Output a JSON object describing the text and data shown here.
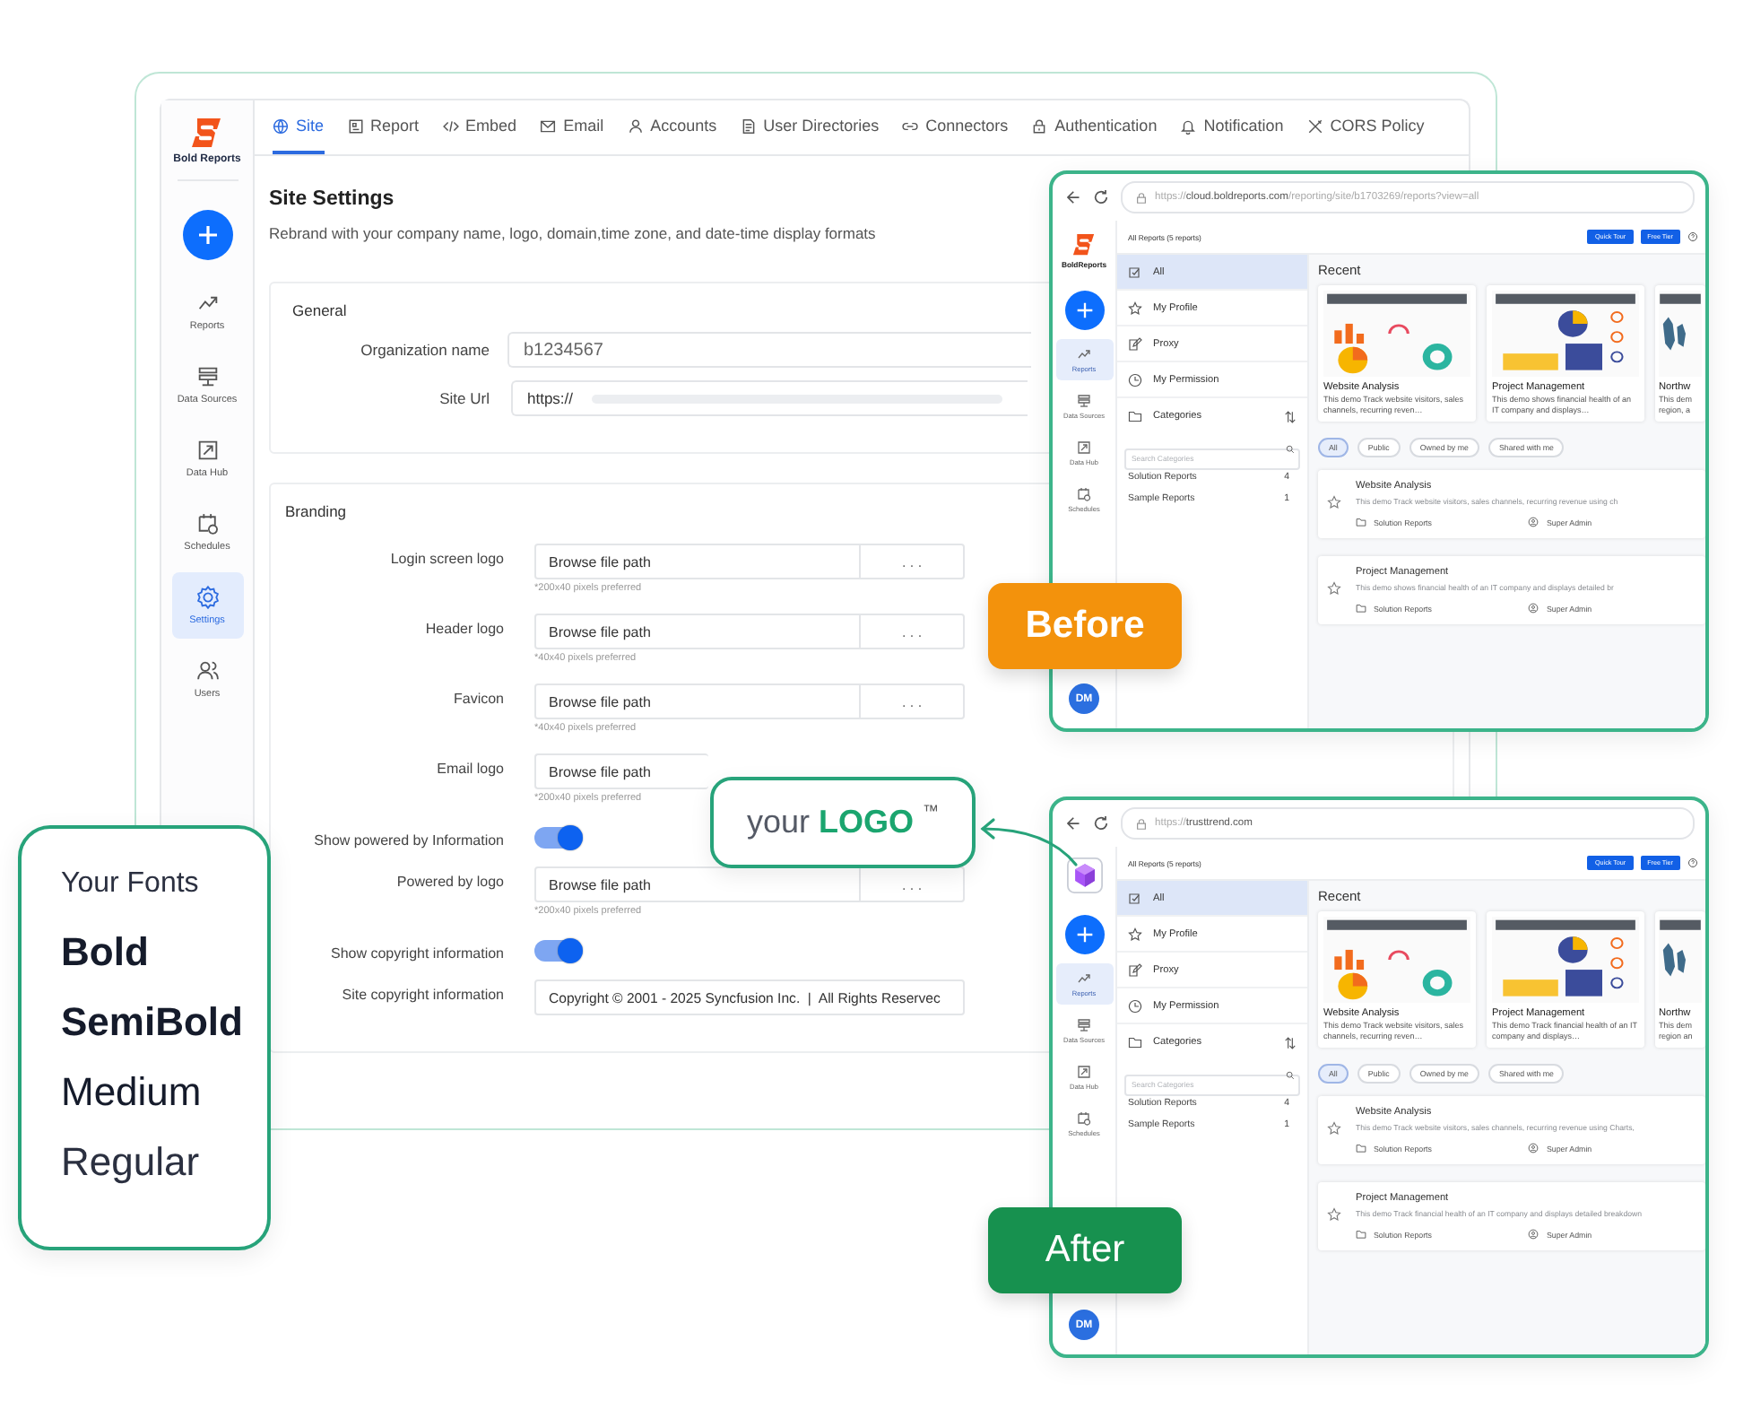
{
  "app": {
    "logo_text": "Bold Reports",
    "sidebar": [
      {
        "label": "Reports",
        "selected": false
      },
      {
        "label": "Data Sources",
        "selected": false
      },
      {
        "label": "Data Hub",
        "selected": false
      },
      {
        "label": "Schedules",
        "selected": false
      },
      {
        "label": "Settings",
        "selected": true
      },
      {
        "label": "Users",
        "selected": false
      }
    ],
    "tabs": [
      {
        "label": "Site",
        "selected": true
      },
      {
        "label": "Report",
        "selected": false
      },
      {
        "label": "Embed",
        "selected": false
      },
      {
        "label": "Email",
        "selected": false
      },
      {
        "label": "Accounts",
        "selected": false
      },
      {
        "label": "User Directories",
        "selected": false
      },
      {
        "label": "Connectors",
        "selected": false
      },
      {
        "label": "Authentication",
        "selected": false
      },
      {
        "label": "Notification",
        "selected": false
      },
      {
        "label": "CORS Policy",
        "selected": false
      }
    ],
    "title": "Site Settings",
    "subtitle": "Rebrand with your company name, logo, domain,time zone, and date-time display formats",
    "general": {
      "title": "General",
      "fields": [
        {
          "label": "Organization name",
          "value": "b1234567"
        },
        {
          "label": "Site Url",
          "value": "https://"
        }
      ]
    },
    "branding": {
      "title": "Branding",
      "rows": [
        {
          "kind": "file",
          "label": "Login screen logo",
          "value": "Browse file path",
          "button": ". . .",
          "hint": "*200x40 pixels preferred"
        },
        {
          "kind": "file",
          "label": "Header logo",
          "value": "Browse file path",
          "button": ". . .",
          "hint": "*40x40 pixels preferred"
        },
        {
          "kind": "file",
          "label": "Favicon",
          "value": "Browse file path",
          "button": ". . .",
          "hint": "*40x40 pixels preferred"
        },
        {
          "kind": "file",
          "label": "Email logo",
          "value": "Browse file path",
          "hint": "*200x40 pixels preferred"
        },
        {
          "kind": "toggle",
          "label": "Show powered by Information",
          "on": true
        },
        {
          "kind": "file",
          "label": "Powered by logo",
          "value": "Browse file path",
          "button": ". . .",
          "hint": "*200x40 pixels preferred"
        },
        {
          "kind": "toggle",
          "label": "Show copyright information",
          "on": true
        },
        {
          "kind": "text",
          "label": "Site copyright information",
          "value": "Copyright © 2001 - 2025 Syncfusion Inc.  |  All Rights Reservec"
        }
      ]
    }
  },
  "windows": [
    {
      "kind": "before",
      "badge": "Before",
      "url": {
        "scheme": "https://",
        "host": "cloud.boldreports.com",
        "path": "/reporting/site/b1703269/reports?view=all"
      },
      "logo_text": "BoldReports",
      "sidebar": [
        {
          "label": "Reports",
          "selected": true
        },
        {
          "label": "Data Sources",
          "selected": false
        },
        {
          "label": "Data Hub",
          "selected": false
        },
        {
          "label": "Schedules",
          "selected": false
        }
      ],
      "avatar": "DM",
      "heading": "All Reports (5 reports)",
      "buttons": [
        "Quick Tour",
        "Free Tier"
      ],
      "nav": [
        {
          "label": "All",
          "selected": true
        },
        {
          "label": "My Profile",
          "selected": false
        },
        {
          "label": "Proxy",
          "selected": false
        },
        {
          "label": "My Permission",
          "selected": false
        }
      ],
      "categories_label": "Categories",
      "search_placeholder": "Search Categories",
      "categories": [
        {
          "name": "Solution Reports",
          "count": "4"
        },
        {
          "name": "Sample Reports",
          "count": "1"
        }
      ],
      "recent_title": "Recent",
      "recent": [
        {
          "title": "Website Analysis",
          "description": "This demo Track website visitors, sales channels, recurring reven…"
        },
        {
          "title": "Project Management",
          "description": "This demo shows financial health of an IT company and displays…"
        },
        {
          "title": "Northw",
          "description": "This dem region, a"
        }
      ],
      "filters": [
        {
          "label": "All",
          "selected": true
        },
        {
          "label": "Public",
          "selected": false
        },
        {
          "label": "Owned by me",
          "selected": false
        },
        {
          "label": "Shared with me",
          "selected": false
        }
      ],
      "reports": [
        {
          "title": "Website Analysis",
          "description": "This demo Track website visitors, sales channels, recurring revenue using ch",
          "category": "Solution Reports",
          "owner": "Super Admin"
        },
        {
          "title": "Project Management",
          "description": "This demo shows financial health of an IT company and displays detailed br",
          "category": "Solution Reports",
          "owner": "Super Admin"
        }
      ]
    },
    {
      "kind": "after",
      "badge": "After",
      "url": {
        "scheme": "https://",
        "host": "trusttrend.com"
      },
      "sidebar": [
        {
          "label": "Reports",
          "selected": true
        },
        {
          "label": "Data Sources",
          "selected": false
        },
        {
          "label": "Data Hub",
          "selected": false
        },
        {
          "label": "Schedules",
          "selected": false
        }
      ],
      "avatar": "DM",
      "heading": "All Reports (5 reports)",
      "buttons": [
        "Quick Tour",
        "Free Tier"
      ],
      "nav": [
        {
          "label": "All",
          "selected": true
        },
        {
          "label": "My Profile",
          "selected": false
        },
        {
          "label": "Proxy",
          "selected": false
        },
        {
          "label": "My Permission",
          "selected": false
        }
      ],
      "categories_label": "Categories",
      "search_placeholder": "Search Categories",
      "categories": [
        {
          "name": "Solution Reports",
          "count": "4"
        },
        {
          "name": "Sample Reports",
          "count": "1"
        }
      ],
      "recent_title": "Recent",
      "recent": [
        {
          "title": "Website Analysis",
          "description": "This demo Track website visitors, sales channels, recurring reven…"
        },
        {
          "title": "Project Management",
          "description": "This demo Track financial health of an IT company and displays…"
        },
        {
          "title": "Northw",
          "description": "This dem region an"
        }
      ],
      "filters": [
        {
          "label": "All",
          "selected": true
        },
        {
          "label": "Public",
          "selected": false
        },
        {
          "label": "Owned by me",
          "selected": false
        },
        {
          "label": "Shared with me",
          "selected": false
        }
      ],
      "reports": [
        {
          "title": "Website Analysis",
          "description": "This demo Track website visitors, sales channels, recurring revenue using Charts,",
          "category": "Solution Reports",
          "owner": "Super Admin"
        },
        {
          "title": "Project Management",
          "description": "This demo Track financial health of an IT company and displays detailed breakdown",
          "category": "Solution Reports",
          "owner": "Super Admin"
        }
      ]
    }
  ],
  "logo_callout": {
    "prefix": "your",
    "word": "LOGO",
    "mark": "™"
  },
  "fonts_card": {
    "title": "Your Fonts",
    "samples": [
      {
        "kind": "bold",
        "label": "Bold"
      },
      {
        "kind": "semibold",
        "label": "SemiBold"
      },
      {
        "kind": "medium",
        "label": "Medium"
      },
      {
        "kind": "regular",
        "label": "Regular"
      }
    ]
  }
}
